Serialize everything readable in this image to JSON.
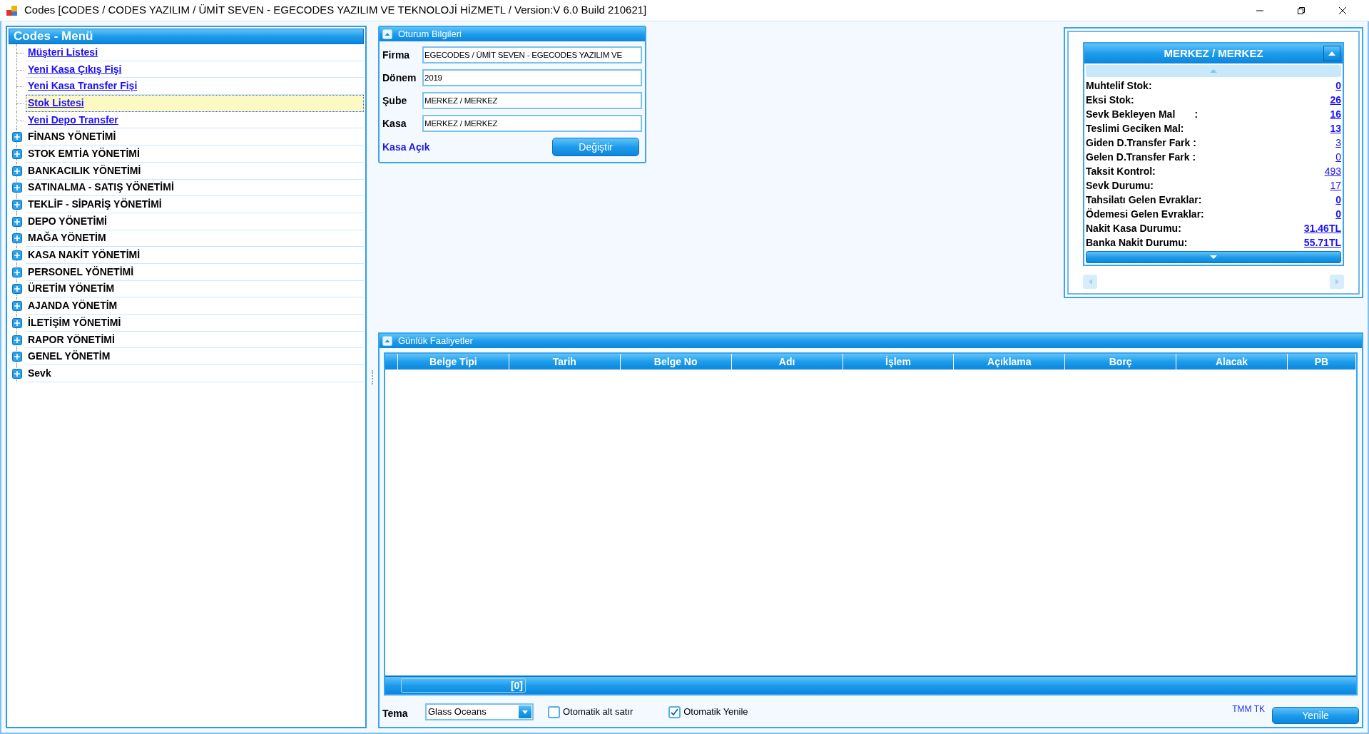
{
  "window": {
    "title": "Codes [CODES / CODES YAZILIM / ÜMİT SEVEN - EGECODES YAZILIM VE TEKNOLOJİ HİZMETL / Version:V 6.0 Build 210621]"
  },
  "menu": {
    "title": "Codes - Menü",
    "items": [
      {
        "kind": "link",
        "label": "Müşteri Listesi",
        "selected": false
      },
      {
        "kind": "link",
        "label": "Yeni Kasa Çıkış Fişi",
        "selected": false
      },
      {
        "kind": "link",
        "label": "Yeni Kasa Transfer Fişi",
        "selected": false
      },
      {
        "kind": "link",
        "label": "Stok Listesi",
        "selected": true
      },
      {
        "kind": "link",
        "label": "Yeni Depo Transfer",
        "selected": false
      },
      {
        "kind": "group",
        "label": "FİNANS YÖNETİMİ",
        "selected": false,
        "expanded": false
      },
      {
        "kind": "group",
        "label": "STOK EMTİA YÖNETİMİ",
        "selected": false,
        "expanded": false
      },
      {
        "kind": "group",
        "label": "BANKACILIK YÖNETİMİ",
        "selected": false,
        "expanded": false
      },
      {
        "kind": "group",
        "label": "SATINALMA - SATIŞ YÖNETİMİ",
        "selected": false,
        "expanded": false
      },
      {
        "kind": "group",
        "label": "TEKLİF - SİPARİŞ YÖNETİMİ",
        "selected": false,
        "expanded": false
      },
      {
        "kind": "group",
        "label": "DEPO YÖNETİMİ",
        "selected": false,
        "expanded": false
      },
      {
        "kind": "group",
        "label": "MAĞA YÖNETİM",
        "selected": false,
        "expanded": false
      },
      {
        "kind": "group",
        "label": "KASA NAKİT YÖNETİMİ",
        "selected": false,
        "expanded": false
      },
      {
        "kind": "group",
        "label": "PERSONEL YÖNETİMİ",
        "selected": false,
        "expanded": false
      },
      {
        "kind": "group",
        "label": "ÜRETİM YÖNETİM",
        "selected": false,
        "expanded": false
      },
      {
        "kind": "group",
        "label": "AJANDA YÖNETİM",
        "selected": false,
        "expanded": false
      },
      {
        "kind": "group",
        "label": "İLETİŞİM YÖNETİMİ",
        "selected": false,
        "expanded": false
      },
      {
        "kind": "group",
        "label": "RAPOR YÖNETİMİ",
        "selected": false,
        "expanded": false
      },
      {
        "kind": "group",
        "label": "GENEL YÖNETİM",
        "selected": false,
        "expanded": false
      },
      {
        "kind": "group",
        "label": "Sevk",
        "selected": false,
        "expanded": false
      }
    ]
  },
  "session": {
    "title": "Oturum Bilgileri",
    "fields": [
      {
        "label": "Firma",
        "value": "EGECODES / ÜMİT SEVEN - EGECODES YAZILIM VE"
      },
      {
        "label": "Dönem",
        "value": "2019"
      },
      {
        "label": "Şube",
        "value": "MERKEZ / MERKEZ"
      },
      {
        "label": "Kasa",
        "value": "MERKEZ / MERKEZ"
      }
    ],
    "status": "Kasa Açık",
    "button": "Değiştir"
  },
  "summary": {
    "title": "MERKEZ / MERKEZ",
    "rows": [
      {
        "label": "Muhtelif Stok:",
        "value": "0",
        "bold": true
      },
      {
        "label": "Eksi Stok:",
        "value": "26",
        "bold": true
      },
      {
        "label": "Sevk Bekleyen Mal       :",
        "value": "16",
        "bold": true
      },
      {
        "label": "Teslimi Geciken Mal:",
        "value": "13",
        "bold": true
      },
      {
        "label": "Giden D.Transfer Fark :",
        "value": "3",
        "bold": false
      },
      {
        "label": "Gelen D.Transfer Fark :",
        "value": "0",
        "bold": false
      },
      {
        "label": "Taksit Kontrol:",
        "value": "493",
        "bold": false
      },
      {
        "label": "Sevk Durumu:",
        "value": "17",
        "bold": false
      },
      {
        "label": "Tahsilatı Gelen Evraklar:",
        "value": "0",
        "bold": true
      },
      {
        "label": "Ödemesi Gelen Evraklar:",
        "value": "0",
        "bold": true
      },
      {
        "label": "Nakit Kasa Durumu:",
        "value": "31.46TL",
        "bold": true
      },
      {
        "label": "Banka Nakit Durumu:",
        "value": "55.71TL",
        "bold": true
      }
    ]
  },
  "activities": {
    "title": "Günlük Faaliyetler",
    "columns": [
      "Belge Tipi",
      "Tarih",
      "Belge No",
      "Adı",
      "İşlem",
      "Açıklama",
      "Borç",
      "Alacak",
      "PB"
    ],
    "footer_count": "[0]"
  },
  "bottom": {
    "theme_label": "Tema",
    "theme_value": "Glass Oceans",
    "checkboxes": [
      {
        "label": "Otomatik alt satır",
        "checked": false
      },
      {
        "label": "Otomatik Yenile",
        "checked": true
      }
    ],
    "tag": "TMM TK",
    "button": "Yenile"
  }
}
